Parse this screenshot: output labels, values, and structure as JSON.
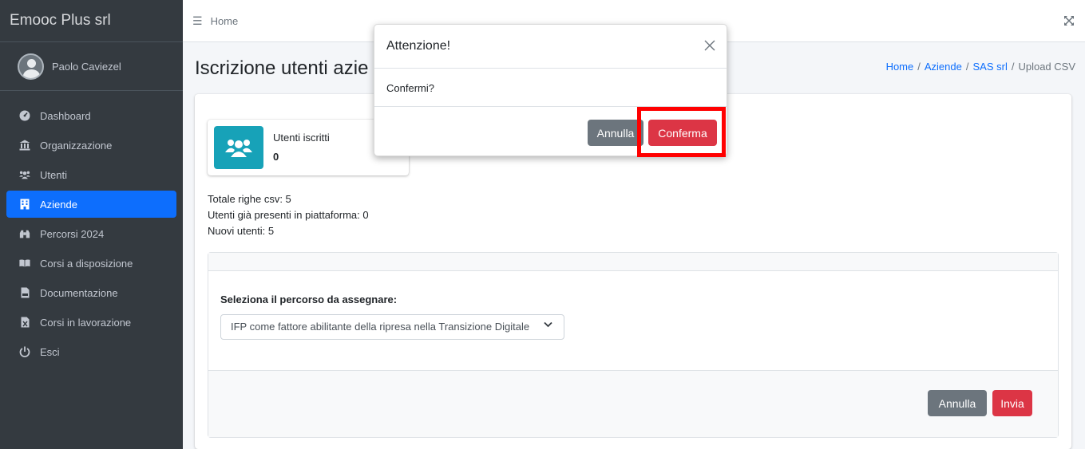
{
  "brand": "Emooc Plus srl",
  "user": {
    "name": "Paolo Caviezel"
  },
  "sidebar": {
    "items": [
      {
        "label": "Dashboard",
        "icon": "dashboard-icon",
        "active": false
      },
      {
        "label": "Organizzazione",
        "icon": "bank-icon",
        "active": false
      },
      {
        "label": "Utenti",
        "icon": "users-icon",
        "active": false
      },
      {
        "label": "Aziende",
        "icon": "building-icon",
        "active": true
      },
      {
        "label": "Percorsi 2024",
        "icon": "binoculars-icon",
        "active": false
      },
      {
        "label": "Corsi a disposizione",
        "icon": "book-icon",
        "active": false
      },
      {
        "label": "Documentazione",
        "icon": "pdf-file-icon",
        "active": false
      },
      {
        "label": "Corsi in lavorazione",
        "icon": "excel-file-icon",
        "active": false
      },
      {
        "label": "Esci",
        "icon": "power-icon",
        "active": false
      }
    ]
  },
  "topbar": {
    "home": "Home"
  },
  "page": {
    "title": "Iscrizione utenti azie",
    "breadcrumb": [
      "Home",
      "Aziende",
      "SAS srl",
      "Upload CSV"
    ]
  },
  "info_box": {
    "label": "Utenti iscritti",
    "value": "0"
  },
  "stats": {
    "totale": "Totale righe csv: 5",
    "presenti": "Utenti già presenti in piattaforma: 0",
    "nuovi": "Nuovi utenti: 5"
  },
  "form": {
    "select_label": "Seleziona il percorso da assegnare:",
    "selected": "IFP come fattore abilitante della ripresa nella Transizione Digitale",
    "annulla": "Annulla",
    "invia": "Invia"
  },
  "modal": {
    "title": "Attenzione!",
    "body": "Confermi?",
    "annulla": "Annulla",
    "conferma": "Conferma"
  },
  "colors": {
    "sidebar_bg": "#343a40",
    "active": "#0d6efd",
    "danger": "#dc3545",
    "secondary": "#6c757d",
    "info": "#17a2b8",
    "highlight": "#ff0000"
  }
}
